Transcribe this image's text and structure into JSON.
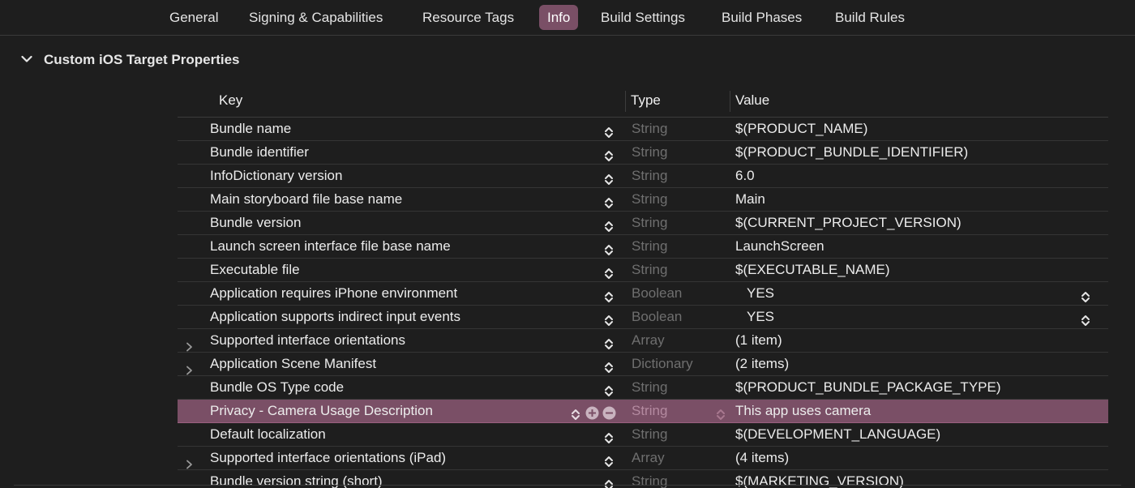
{
  "tabs": [
    {
      "label": "General",
      "active": false
    },
    {
      "label": "Signing & Capabilities",
      "active": false
    },
    {
      "label": "Resource Tags",
      "active": false
    },
    {
      "label": "Info",
      "active": true
    },
    {
      "label": "Build Settings",
      "active": false
    },
    {
      "label": "Build Phases",
      "active": false
    },
    {
      "label": "Build Rules",
      "active": false
    }
  ],
  "section": {
    "title": "Custom iOS Target Properties",
    "expanded": true
  },
  "table": {
    "headers": {
      "key": "Key",
      "type": "Type",
      "value": "Value"
    },
    "rows": [
      {
        "key": "Bundle name",
        "type": "String",
        "value": "$(PRODUCT_NAME)",
        "expandable": false,
        "selected": false,
        "value_popup": false
      },
      {
        "key": "Bundle identifier",
        "type": "String",
        "value": "$(PRODUCT_BUNDLE_IDENTIFIER)",
        "expandable": false,
        "selected": false,
        "value_popup": false
      },
      {
        "key": "InfoDictionary version",
        "type": "String",
        "value": "6.0",
        "expandable": false,
        "selected": false,
        "value_popup": false
      },
      {
        "key": "Main storyboard file base name",
        "type": "String",
        "value": "Main",
        "expandable": false,
        "selected": false,
        "value_popup": false
      },
      {
        "key": "Bundle version",
        "type": "String",
        "value": "$(CURRENT_PROJECT_VERSION)",
        "expandable": false,
        "selected": false,
        "value_popup": false
      },
      {
        "key": "Launch screen interface file base name",
        "type": "String",
        "value": "LaunchScreen",
        "expandable": false,
        "selected": false,
        "value_popup": false
      },
      {
        "key": "Executable file",
        "type": "String",
        "value": "$(EXECUTABLE_NAME)",
        "expandable": false,
        "selected": false,
        "value_popup": false
      },
      {
        "key": "Application requires iPhone environment",
        "type": "Boolean",
        "value": "YES",
        "expandable": false,
        "selected": false,
        "value_popup": true
      },
      {
        "key": "Application supports indirect input events",
        "type": "Boolean",
        "value": "YES",
        "expandable": false,
        "selected": false,
        "value_popup": true
      },
      {
        "key": "Supported interface orientations",
        "type": "Array",
        "value": "(1 item)",
        "expandable": true,
        "selected": false,
        "value_popup": false
      },
      {
        "key": "Application Scene Manifest",
        "type": "Dictionary",
        "value": "(2 items)",
        "expandable": true,
        "selected": false,
        "value_popup": false
      },
      {
        "key": "Bundle OS Type code",
        "type": "String",
        "value": "$(PRODUCT_BUNDLE_PACKAGE_TYPE)",
        "expandable": false,
        "selected": false,
        "value_popup": false
      },
      {
        "key": "Privacy - Camera Usage Description",
        "type": "String",
        "value": "This app uses camera",
        "expandable": false,
        "selected": true,
        "value_popup": false
      },
      {
        "key": "Default localization",
        "type": "String",
        "value": "$(DEVELOPMENT_LANGUAGE)",
        "expandable": false,
        "selected": false,
        "value_popup": false
      },
      {
        "key": "Supported interface orientations (iPad)",
        "type": "Array",
        "value": "(4 items)",
        "expandable": true,
        "selected": false,
        "value_popup": false
      },
      {
        "key": "Bundle version string (short)",
        "type": "String",
        "value": "$(MARKETING_VERSION)",
        "expandable": false,
        "selected": false,
        "value_popup": false
      }
    ]
  },
  "colors": {
    "background": "#1e1e1e",
    "accent": "#7a4f66",
    "type_text": "#6f6f6f"
  }
}
